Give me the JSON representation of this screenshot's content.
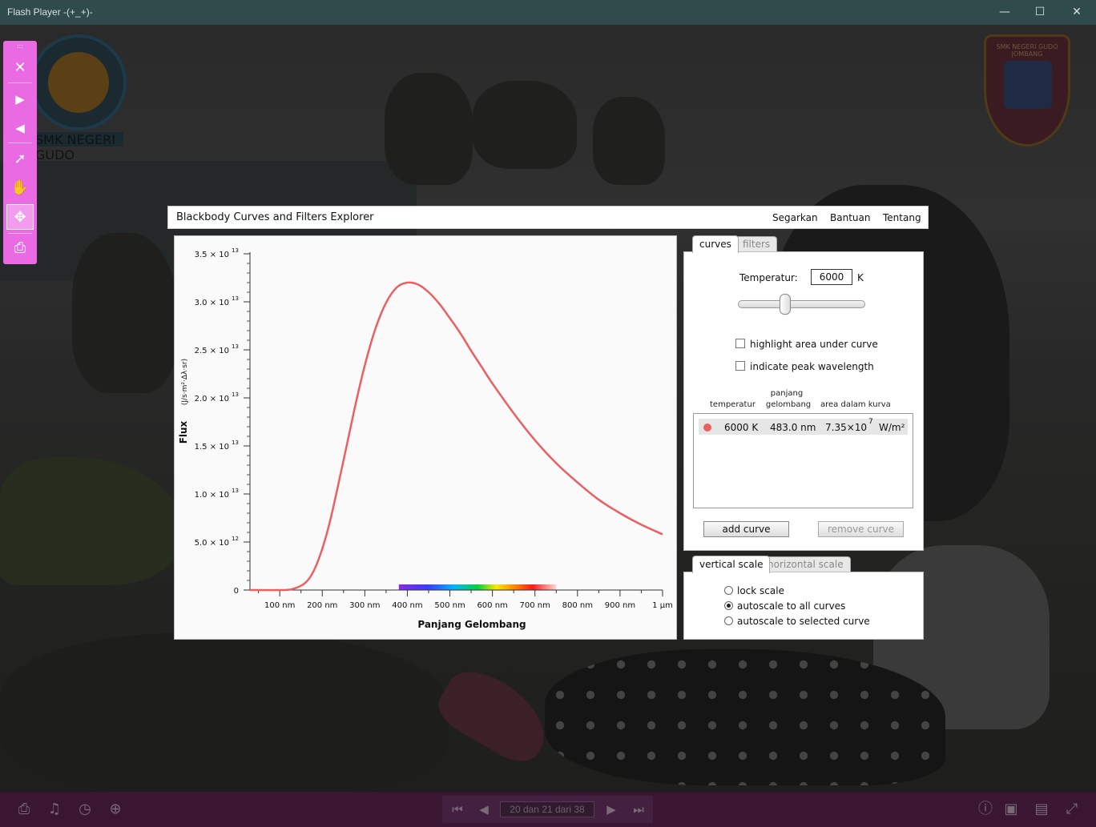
{
  "window": {
    "title": "Flash Player  -(+_+)-",
    "minimize_glyph": "—",
    "maximize_glyph": "☐",
    "close_glyph": "✕"
  },
  "background": {
    "logo_left_text": "SMK NEGERI GUDO",
    "logo_right_text": "SMK NEGERI GUDO JOMBANG"
  },
  "float_toolbar": {
    "grip": ":::",
    "close": "✕",
    "next": "▶",
    "prev": "◀",
    "select": "➚",
    "hand": "✋",
    "move": "✥",
    "print": "⎙"
  },
  "app": {
    "title": "Blackbody Curves and Filters Explorer",
    "menu": [
      "Segarkan",
      "Bantuan",
      "Tentang"
    ]
  },
  "chart_data": {
    "type": "line",
    "xlabel": "Panjang Gelombang",
    "ylabel": "Flux",
    "ylabel_units": "(J/s·m²·Δλ·sr)",
    "xlim": [
      30,
      1000
    ],
    "ylim": [
      0,
      35000000000000.0
    ],
    "x_ticks": [
      {
        "v": 100,
        "label": "100 nm"
      },
      {
        "v": 200,
        "label": "200 nm"
      },
      {
        "v": 300,
        "label": "300 nm"
      },
      {
        "v": 400,
        "label": "400 nm"
      },
      {
        "v": 500,
        "label": "500 nm"
      },
      {
        "v": 600,
        "label": "600 nm"
      },
      {
        "v": 700,
        "label": "700 nm"
      },
      {
        "v": 800,
        "label": "800 nm"
      },
      {
        "v": 900,
        "label": "900 nm"
      },
      {
        "v": 1000,
        "label": "1 μm"
      }
    ],
    "y_ticks": [
      {
        "v": 0,
        "mant": "0",
        "exp": ""
      },
      {
        "v": 5000000000000.0,
        "mant": "5.0 × 10",
        "exp": "12"
      },
      {
        "v": 10000000000000.0,
        "mant": "1.0 × 10",
        "exp": "13"
      },
      {
        "v": 15000000000000.0,
        "mant": "1.5 × 10",
        "exp": "13"
      },
      {
        "v": 20000000000000.0,
        "mant": "2.0 × 10",
        "exp": "13"
      },
      {
        "v": 25000000000000.0,
        "mant": "2.5 × 10",
        "exp": "13"
      },
      {
        "v": 30000000000000.0,
        "mant": "3.0 × 10",
        "exp": "13"
      },
      {
        "v": 35000000000000.0,
        "mant": "3.5 × 10",
        "exp": "13"
      }
    ],
    "grid": false,
    "curve_color": "#ea5f61",
    "spectrum_band": [
      380,
      750
    ],
    "series": [
      {
        "temperature_K": 6000,
        "x": [
          30,
          100,
          130,
          160,
          180,
          200,
          220,
          250,
          275,
          300,
          325,
          350,
          375,
          400,
          425,
          450,
          475,
          500,
          525,
          550,
          575,
          600,
          650,
          700,
          750,
          800,
          850,
          900,
          950,
          1000
        ],
        "y": [
          0,
          1000000000.0,
          100000000000.0,
          740000000000.0,
          2000000000000.0,
          4300000000000.0,
          7500000000000.0,
          13500000000000.0,
          18700000000000.0,
          23400000000000.0,
          27200000000000.0,
          29900000000000.0,
          31500000000000.0,
          32000000000000.0,
          31800000000000.0,
          31000000000000.0,
          29800000000000.0,
          28300000000000.0,
          26700000000000.0,
          24900000000000.0,
          23200000000000.0,
          21500000000000.0,
          18400000000000.0,
          15600000000000.0,
          13200000000000.0,
          11200000000000.0,
          9400000000000.0,
          8000000000000.0,
          6800000000000.0,
          5800000000000.0
        ]
      }
    ]
  },
  "curves_panel": {
    "tabs": [
      "curves",
      "filters"
    ],
    "temperature_label": "Temperatur:",
    "temperature_value": "6000",
    "temperature_unit": "K",
    "slider_value_fraction": 0.36,
    "highlight_label": "highlight area under curve",
    "peak_label": "indicate peak wavelength",
    "table_headers": {
      "temperature": "temperatur",
      "wavelength_line1": "panjang",
      "wavelength_line2": "gelombang",
      "area": "area dalam kurva"
    },
    "rows": [
      {
        "temperature": "6000 K",
        "wavelength": "483.0 nm",
        "area_mant": "7.35×10",
        "area_exp": "7",
        "area_unit": "W/m²"
      }
    ],
    "add_button": "add curve",
    "remove_button": "remove curve"
  },
  "scale_panel": {
    "tabs": [
      "vertical scale",
      "horizontal scale"
    ],
    "options": [
      "lock scale",
      "autoscale to all curves",
      "autoscale to selected curve"
    ],
    "selected_index": 1
  },
  "bottom_bar": {
    "page_text": "20 dan 21 dari 38",
    "icons": {
      "print": "⎙",
      "music": "♫",
      "clock": "◷",
      "zoom": "⊕",
      "first": "⏮",
      "prev": "◀",
      "next": "▶",
      "last": "⏭",
      "info": "ⓘ",
      "chat": "▣",
      "book": "▤",
      "fullscreen": "⤢"
    }
  }
}
